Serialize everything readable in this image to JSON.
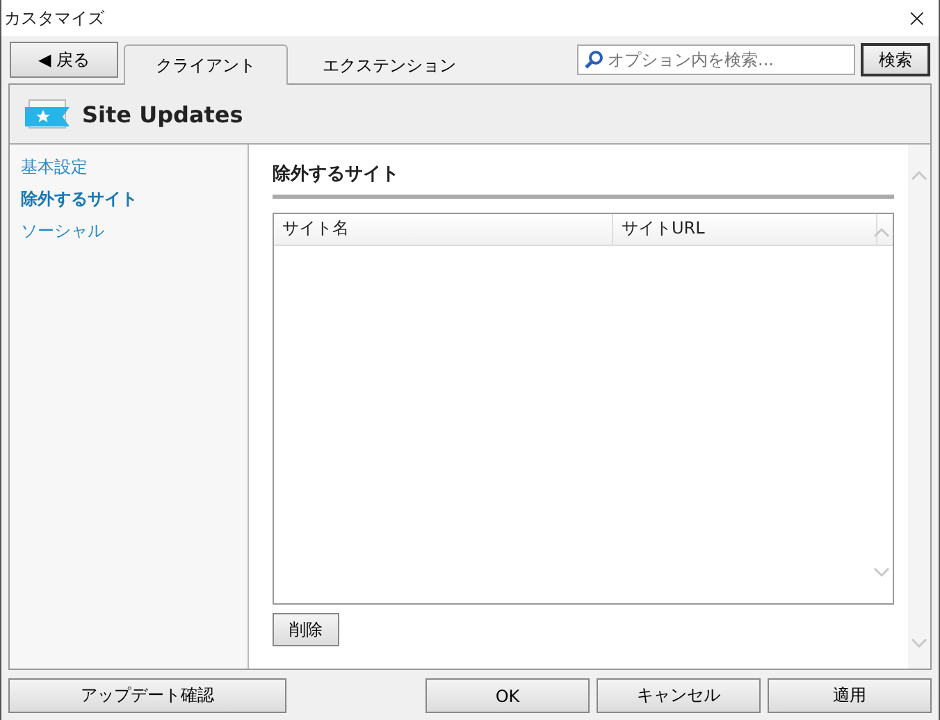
{
  "window": {
    "title": "カスタマイズ",
    "close": "×"
  },
  "toolbar": {
    "back": "◀ 戻る",
    "tabs": [
      {
        "label": "クライアント",
        "selected": true
      },
      {
        "label": "エクステンション",
        "selected": false
      }
    ],
    "search": {
      "placeholder": "オプション内を検索..."
    },
    "search_button": "検索"
  },
  "header": {
    "title": "Site Updates"
  },
  "sidebar": {
    "items": [
      {
        "label": "基本設定",
        "selected": false
      },
      {
        "label": "除外するサイト",
        "selected": true
      },
      {
        "label": "ソーシャル",
        "selected": false
      }
    ]
  },
  "content": {
    "title": "除外するサイト",
    "table": {
      "columns": [
        "サイト名",
        "サイトURL"
      ]
    },
    "delete_button": "削除"
  },
  "footer": {
    "update_button": "アップデート確認",
    "buttons": [
      "OK",
      "キャンセル",
      "適用"
    ]
  }
}
